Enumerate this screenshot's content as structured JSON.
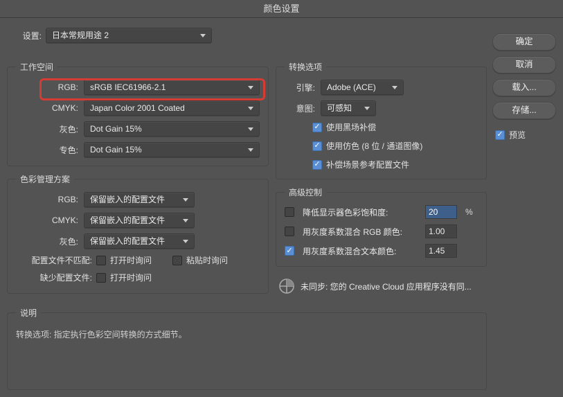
{
  "title": "颜色设置",
  "settings": {
    "label": "设置:",
    "value": "日本常规用途 2"
  },
  "workspace": {
    "legend": "工作空间",
    "rgb_label": "RGB:",
    "rgb_value": "sRGB IEC61966-2.1",
    "cmyk_label": "CMYK:",
    "cmyk_value": "Japan Color 2001 Coated",
    "gray_label": "灰色:",
    "gray_value": "Dot Gain 15%",
    "spot_label": "专色:",
    "spot_value": "Dot Gain 15%"
  },
  "color_mgmt": {
    "legend": "色彩管理方案",
    "rgb_label": "RGB:",
    "rgb_value": "保留嵌入的配置文件",
    "cmyk_label": "CMYK:",
    "cmyk_value": "保留嵌入的配置文件",
    "gray_label": "灰色:",
    "gray_value": "保留嵌入的配置文件",
    "mismatch_label": "配置文件不匹配:",
    "ask_open": "打开时询问",
    "ask_paste": "粘贴时询问",
    "missing_label": "缺少配置文件:",
    "ask_open2": "打开时询问"
  },
  "conversion": {
    "legend": "转换选项",
    "engine_label": "引擎:",
    "engine_value": "Adobe (ACE)",
    "intent_label": "意图:",
    "intent_value": "可感知",
    "bpc": "使用黑场补偿",
    "dither": "使用仿色 (8 位 / 通道图像)",
    "scene_ref": "补偿场景参考配置文件"
  },
  "advanced": {
    "legend": "高级控制",
    "desat_label": "降低显示器色彩饱和度:",
    "desat_value": "20",
    "pct": "%",
    "blend_rgb_label": "用灰度系数混合 RGB 颜色:",
    "blend_rgb_value": "1.00",
    "blend_text_label": "用灰度系数混合文本颜色:",
    "blend_text_value": "1.45"
  },
  "sync": {
    "text": "未同步: 您的 Creative Cloud 应用程序没有同..."
  },
  "desc": {
    "legend": "说明",
    "body": "转换选项: 指定执行色彩空间转换的方式细节。"
  },
  "buttons": {
    "ok": "确定",
    "cancel": "取消",
    "load": "载入...",
    "save": "存储...",
    "preview": "预览"
  }
}
